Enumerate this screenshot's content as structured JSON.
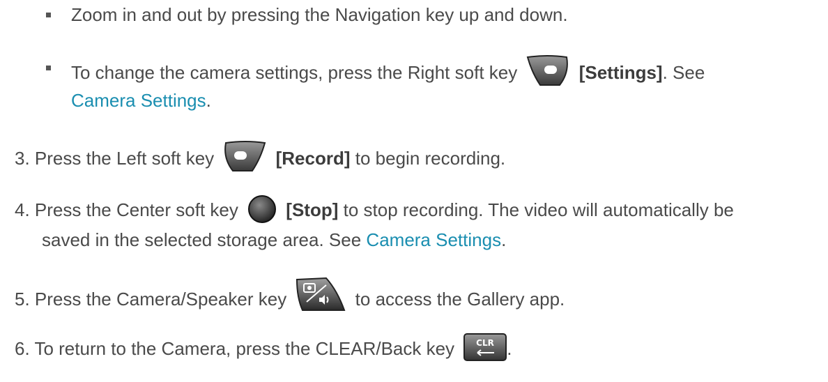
{
  "bullets": {
    "zoom": "Zoom in and out by pressing the Navigation key up and down.",
    "settings_pre": "To change the camera settings, press the Right soft key",
    "settings_label": "[Settings]",
    "settings_post": ". See",
    "settings_link": "Camera Settings",
    "settings_end": "."
  },
  "steps": [
    {
      "num": "3.",
      "pre": "Press the Left soft key",
      "label": "[Record]",
      "post": "to begin recording."
    },
    {
      "num": "4.",
      "pre": "Press the Center soft key",
      "label": "[Stop]",
      "post": "to stop recording. The video will automatically be",
      "line2": "saved in the selected storage area. See",
      "link": "Camera Settings",
      "end": "."
    },
    {
      "num": "5.",
      "pre": "Press the Camera/Speaker key",
      "post": "to access the Gallery app."
    },
    {
      "num": "6.",
      "pre": "To return to the Camera, press the CLEAR/Back key",
      "end": "."
    }
  ],
  "keys": {
    "right_soft": "right-soft-key-icon",
    "left_soft": "left-soft-key-icon",
    "center": "center-key-icon",
    "camera_speaker": "camera-speaker-key-icon",
    "clear": "clear-back-key-icon",
    "clear_text": "CLR"
  },
  "colors": {
    "link": "#1a8eb0",
    "text": "#4a4a4a"
  }
}
